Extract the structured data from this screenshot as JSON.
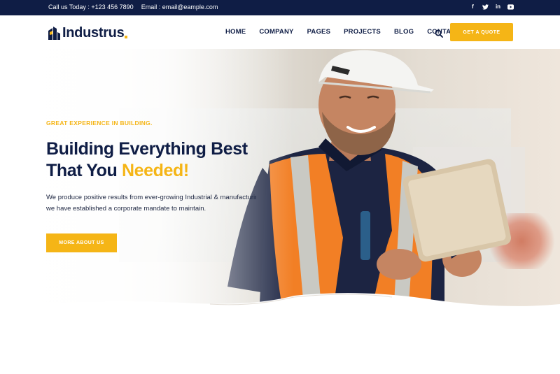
{
  "topbar": {
    "phone": "Call us Today : +123 456 7890",
    "email": "Email : email@eample.com",
    "social": [
      {
        "icon": "facebook-icon",
        "glyph": "f"
      },
      {
        "icon": "twitter-icon",
        "glyph": "t"
      },
      {
        "icon": "linkedin-icon",
        "glyph": "in"
      },
      {
        "icon": "youtube-icon",
        "glyph": "▶"
      }
    ]
  },
  "header": {
    "logo_text": "Industrus",
    "nav": [
      "HOME",
      "COMPANY",
      "PAGES",
      "PROJECTS",
      "BLOG",
      "CONTACT US"
    ],
    "search_icon": "search-icon",
    "cta_label": "GET A QUOTE"
  },
  "hero": {
    "eyebrow": "GREAT EXPERIENCE IN BUILDING.",
    "headline_line1": "Building Everything Best",
    "headline_line2_plain": "That You ",
    "headline_line2_accent": "Needed!",
    "desc_line1": "We produce positive results from ever-growing Industrial & manufacturing",
    "desc_line2": "we have established a corporate mandate to maintain.",
    "button_label": "MORE ABOUT US"
  },
  "colors": {
    "navy": "#0f1d45",
    "accent": "#f5b516",
    "white": "#ffffff"
  }
}
